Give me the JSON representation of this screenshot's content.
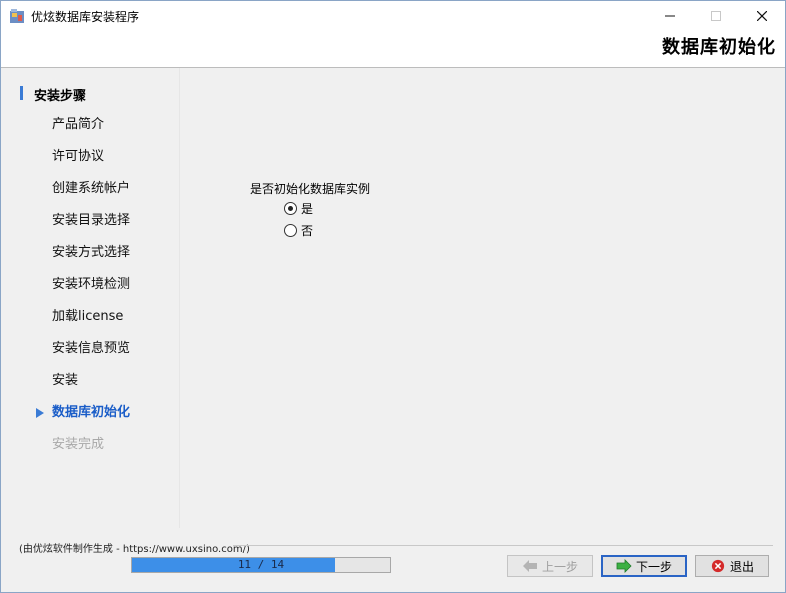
{
  "window": {
    "title": "优炫数据库安装程序",
    "page_heading": "数据库初始化"
  },
  "sidebar": {
    "header": "安装步骤",
    "items": [
      {
        "label": "产品简介",
        "state": "done"
      },
      {
        "label": "许可协议",
        "state": "done"
      },
      {
        "label": "创建系统帐户",
        "state": "done"
      },
      {
        "label": "安装目录选择",
        "state": "done"
      },
      {
        "label": "安装方式选择",
        "state": "done"
      },
      {
        "label": "安装环境检测",
        "state": "done"
      },
      {
        "label": "加载license",
        "state": "done"
      },
      {
        "label": "安装信息预览",
        "state": "done"
      },
      {
        "label": "安装",
        "state": "done"
      },
      {
        "label": "数据库初始化",
        "state": "current"
      },
      {
        "label": "安装完成",
        "state": "future"
      }
    ]
  },
  "main": {
    "question": "是否初始化数据库实例",
    "options": [
      {
        "label": "是",
        "checked": true
      },
      {
        "label": "否",
        "checked": false
      }
    ]
  },
  "footer": {
    "note": "(由优炫软件制作生成 - https://www.uxsino.com/)",
    "progress_text": "11 / 14",
    "progress_fraction": 0.786,
    "prev_label": "上一步",
    "next_label": "下一步",
    "exit_label": "退出"
  },
  "colors": {
    "accent": "#3a7bd5",
    "progress_fill": "#3d8fe8",
    "exit_icon": "#d42a2a",
    "next_icon": "#3cb043"
  }
}
